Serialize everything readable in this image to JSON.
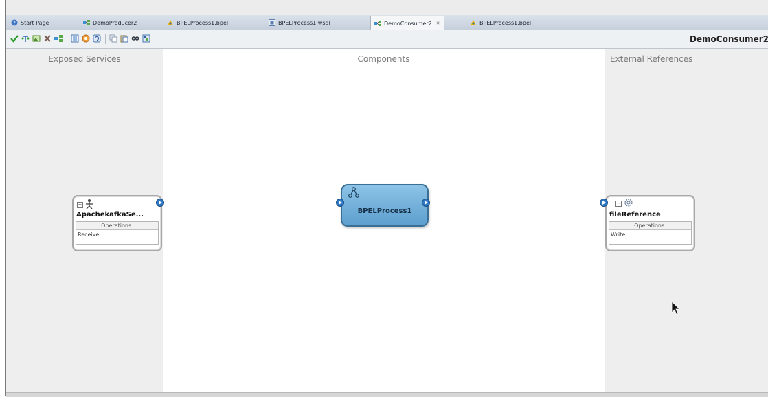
{
  "tabs": [
    {
      "label": "Start Page",
      "icon": "help-icon"
    },
    {
      "label": "DemoProducer2",
      "icon": "composite-icon"
    },
    {
      "label": "BPELProcess1.bpel",
      "icon": "bpel-icon"
    },
    {
      "label": "BPELProcess1.wsdl",
      "icon": "wsdl-icon"
    },
    {
      "label": "DemoConsumer2",
      "icon": "composite-icon",
      "active": true
    },
    {
      "label": "BPELProcess1.bpel",
      "icon": "bpel-icon"
    }
  ],
  "toolbar": {
    "title": "DemoConsumer2",
    "icons": [
      "validate-icon",
      "test-icon",
      "image-icon",
      "delete-icon",
      "layout-icon",
      "zoom-icon",
      "settings-icon",
      "refresh-icon",
      "copy-icon",
      "paste-icon",
      "search-icon",
      "export-icon"
    ]
  },
  "lanes": {
    "exposed_services": "Exposed Services",
    "components": "Components",
    "external_references": "External References"
  },
  "service": {
    "name": "ApachekafkaSe...",
    "operations_label": "Operations:",
    "operations": [
      "Receive"
    ]
  },
  "component": {
    "name": "BPELProcess1"
  },
  "reference": {
    "name": "fileReference",
    "operations_label": "Operations:",
    "operations": [
      "Write"
    ]
  },
  "colors": {
    "tabbar": "#c6d0dc",
    "lane_side": "#eeeeee",
    "lane_center": "#ffffff",
    "component_fill": "#5d9fcf",
    "wire": "#9aa8c6"
  }
}
